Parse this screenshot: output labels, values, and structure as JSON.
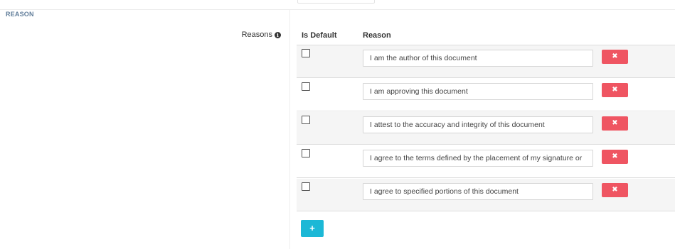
{
  "section": {
    "title": "REASON"
  },
  "field": {
    "label": "Reasons",
    "info_icon": "info-circle-icon"
  },
  "table": {
    "headers": {
      "is_default": "Is Default",
      "reason": "Reason"
    },
    "rows": [
      {
        "is_default": false,
        "reason": "I am the author of this document"
      },
      {
        "is_default": false,
        "reason": "I am approving this document"
      },
      {
        "is_default": false,
        "reason": "I attest to the accuracy and integrity of this document"
      },
      {
        "is_default": false,
        "reason": "I agree to the terms defined by the placement of my signature or"
      },
      {
        "is_default": false,
        "reason": "I agree to specified portions of this document"
      }
    ],
    "remove_glyph": "✖",
    "add_glyph": "+"
  },
  "colors": {
    "section_title": "#607d9a",
    "remove_button": "#ef5562",
    "add_button": "#1cb8d6",
    "row_stripe": "#f5f5f5"
  }
}
